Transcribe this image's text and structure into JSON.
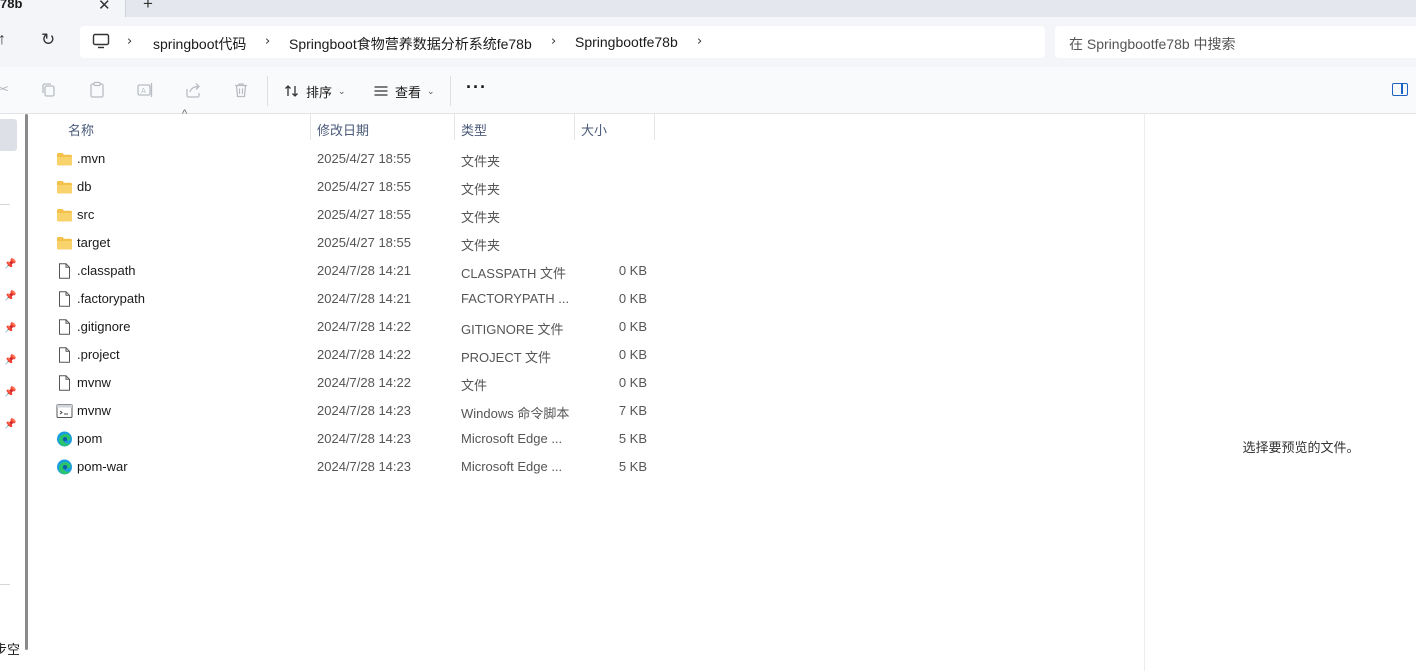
{
  "tab": {
    "title": "78b",
    "close": "✕",
    "new_tab": "+"
  },
  "nav": {
    "up": "↑",
    "refresh": "↻"
  },
  "breadcrumb": [
    "springboot代码",
    "Springboot食物营养数据分析系统fe78b",
    "Springbootfe78b"
  ],
  "breadcrumb_separator": "›",
  "search": {
    "placeholder": "在 Springbootfe78b 中搜索"
  },
  "toolbar": {
    "sort_label": "排序",
    "view_label": "查看",
    "more_label": "···",
    "icons": [
      "cut-icon",
      "copy-icon",
      "paste-icon",
      "rename-icon",
      "share-icon",
      "delete-icon"
    ]
  },
  "leftnav": {
    "bottom_text": "步空"
  },
  "columns": {
    "name": "名称",
    "date": "修改日期",
    "type": "类型",
    "size": "大小"
  },
  "files": [
    {
      "name": ".mvn",
      "date": "2025/4/27 18:55",
      "type": "文件夹",
      "size": "",
      "icon": "folder"
    },
    {
      "name": "db",
      "date": "2025/4/27 18:55",
      "type": "文件夹",
      "size": "",
      "icon": "folder"
    },
    {
      "name": "src",
      "date": "2025/4/27 18:55",
      "type": "文件夹",
      "size": "",
      "icon": "folder"
    },
    {
      "name": "target",
      "date": "2025/4/27 18:55",
      "type": "文件夹",
      "size": "",
      "icon": "folder"
    },
    {
      "name": ".classpath",
      "date": "2024/7/28 14:21",
      "type": "CLASSPATH 文件",
      "size": "0 KB",
      "icon": "file"
    },
    {
      "name": ".factorypath",
      "date": "2024/7/28 14:21",
      "type": "FACTORYPATH ...",
      "size": "0 KB",
      "icon": "file"
    },
    {
      "name": ".gitignore",
      "date": "2024/7/28 14:22",
      "type": "GITIGNORE 文件",
      "size": "0 KB",
      "icon": "file"
    },
    {
      "name": ".project",
      "date": "2024/7/28 14:22",
      "type": "PROJECT 文件",
      "size": "0 KB",
      "icon": "file"
    },
    {
      "name": "mvnw",
      "date": "2024/7/28 14:22",
      "type": "文件",
      "size": "0 KB",
      "icon": "file"
    },
    {
      "name": "mvnw",
      "date": "2024/7/28 14:23",
      "type": "Windows 命令脚本",
      "size": "7 KB",
      "icon": "script"
    },
    {
      "name": "pom",
      "date": "2024/7/28 14:23",
      "type": "Microsoft Edge ...",
      "size": "5 KB",
      "icon": "edge"
    },
    {
      "name": "pom-war",
      "date": "2024/7/28 14:23",
      "type": "Microsoft Edge ...",
      "size": "5 KB",
      "icon": "edge"
    }
  ],
  "preview": {
    "empty_text": "选择要预览的文件。"
  },
  "colors": {
    "accent": "#1d63c6",
    "folder": "#f4c24a",
    "header_text": "#4a5a7a"
  }
}
